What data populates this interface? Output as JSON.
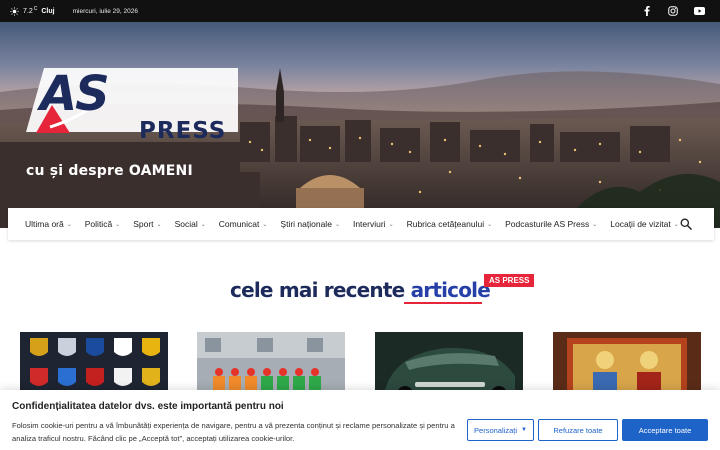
{
  "topbar": {
    "temperature": "7.2",
    "unit": "C",
    "city": "Cluj",
    "date": "miercuri, iulie 29, 2026",
    "social": [
      {
        "icon": "facebook-icon"
      },
      {
        "icon": "instagram-icon"
      },
      {
        "icon": "youtube-icon"
      }
    ]
  },
  "header": {
    "logo_main": "AS",
    "logo_sub": "PRESS",
    "tagline": "cu și despre OAMENI"
  },
  "nav": {
    "items": [
      {
        "label": "Ultima oră",
        "dropdown": true
      },
      {
        "label": "Politică",
        "dropdown": true
      },
      {
        "label": "Sport",
        "dropdown": true
      },
      {
        "label": "Social",
        "dropdown": true
      },
      {
        "label": "Comunicat",
        "dropdown": true
      },
      {
        "label": "Știri naționale",
        "dropdown": true
      },
      {
        "label": "Interviuri",
        "dropdown": true
      },
      {
        "label": "Rubrica cetățeanului",
        "dropdown": true
      },
      {
        "label": "Podcasturile AS Press",
        "dropdown": true
      },
      {
        "label": "Locații de vizitat",
        "dropdown": true
      }
    ],
    "search_icon": "search-icon"
  },
  "section": {
    "title_part1": "cele mai recente ",
    "title_part2": "articole",
    "badge": "AS PRESS"
  },
  "cookie": {
    "title": "Confidențialitatea datelor dvs. este importantă pentru noi",
    "text": "Folosim cookie-uri pentru a vă îmbunătăți experiența de navigare, pentru a vă prezenta conținut și reclame personalizate și pentru a analiza traficul nostru. Făcând clic pe „Acceptă tot”, acceptați utilizarea cookie-urilor.",
    "customize": "Personalizați",
    "reject": "Refuzare toate",
    "accept": "Acceptare toate"
  },
  "colors": {
    "brand_navy": "#1d2a5c",
    "brand_red": "#e6243a",
    "button_blue": "#1e63c8"
  }
}
